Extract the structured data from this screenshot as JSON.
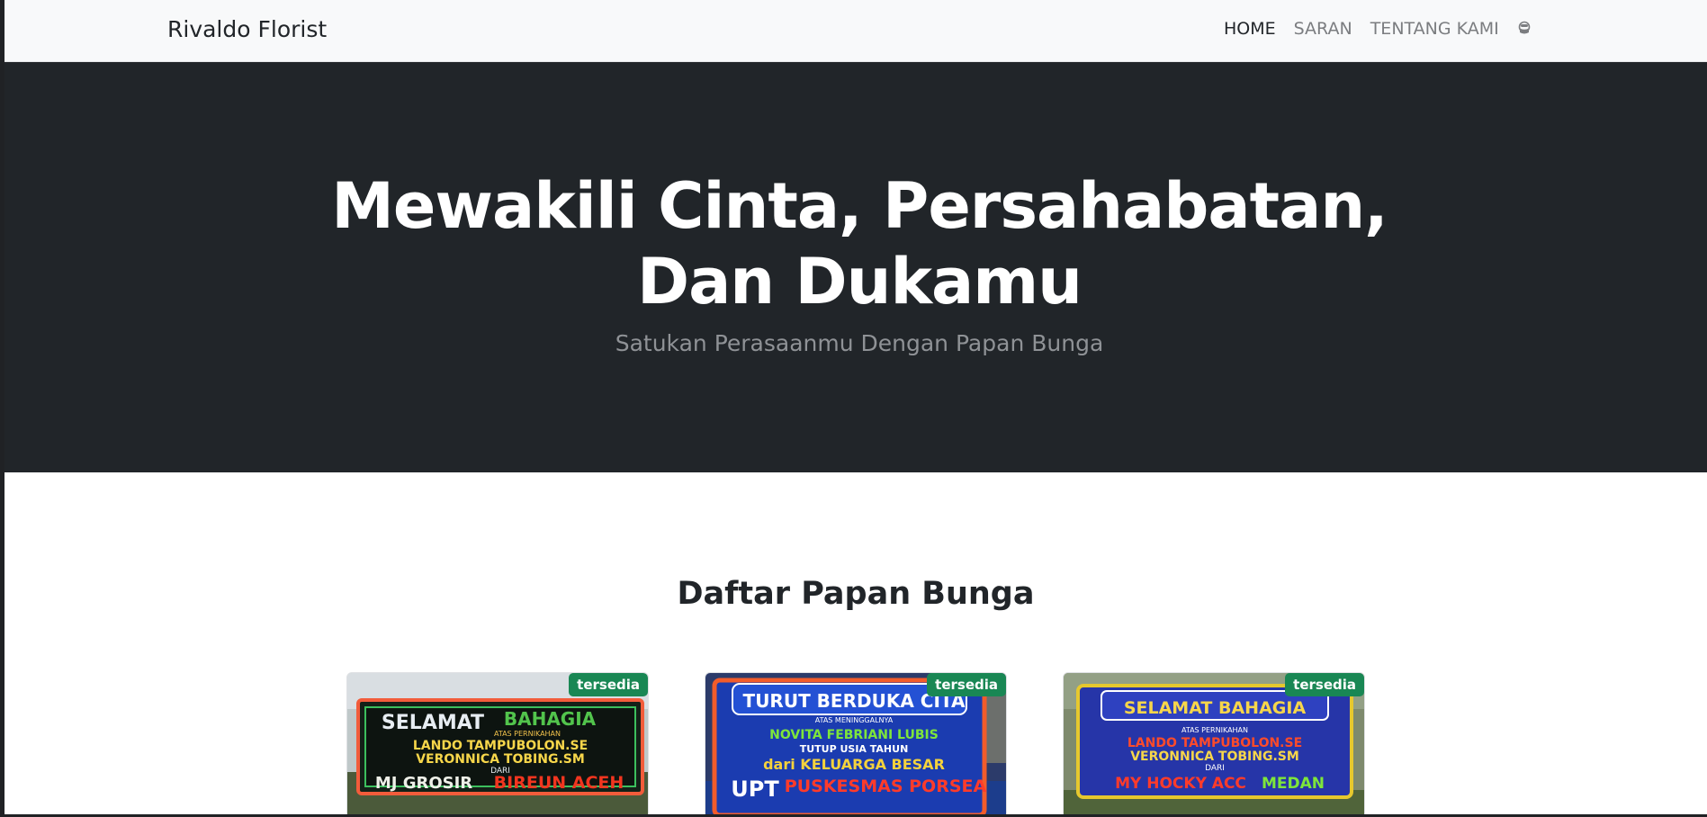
{
  "navbar": {
    "brand": "Rivaldo Florist",
    "links": [
      {
        "label": "HOME"
      },
      {
        "label": "SARAN"
      },
      {
        "label": "TENTANG KAMI"
      }
    ],
    "user_icon": "user-icon"
  },
  "hero": {
    "title": "Mewakili Cinta, Persahabatan, Dan Dukamu",
    "subtitle": "Satukan Perasaanmu Dengan Papan Bunga"
  },
  "section": {
    "title": "Daftar Papan Bunga"
  },
  "cards": [
    {
      "badge": "tersedia",
      "board": {
        "line1a": "SELAMAT",
        "line1b": "BAHAGIA",
        "line2": "ATAS PERNIKAHAN",
        "line3": "LANDO TAMPUBOLON.SE",
        "line4": "VERONNICA TOBING.SM",
        "line5": "DARI",
        "line6a": "MJ GROSIR",
        "line6b": "BIREUN ACEH"
      }
    },
    {
      "badge": "tersedia",
      "board": {
        "line1a": "TURUT BERDUKA CITA",
        "line1b": "",
        "line2": "ATAS MENINGGALNYA",
        "line3": "NOVITA FEBRIANI LUBIS",
        "line4": "TUTUP USIA   TAHUN",
        "line5": "dari KELUARGA BESAR",
        "line6a": "UPT",
        "line6b": "PUSKESMAS PORSEA"
      }
    },
    {
      "badge": "tersedia",
      "board": {
        "line1a": "SELAMAT BAHAGIA",
        "line1b": "",
        "line2": "ATAS PERNIKAHAN",
        "line3": "LANDO TAMPUBOLON.SE",
        "line4": "VERONNICA TOBING.SM",
        "line5": "DARI",
        "line6a": "MY HOCKY ACC",
        "line6b": "MEDAN"
      }
    }
  ],
  "colors": {
    "hero_bg": "#212529",
    "navbar_bg": "#f8f9fa",
    "badge_bg": "#198754"
  }
}
